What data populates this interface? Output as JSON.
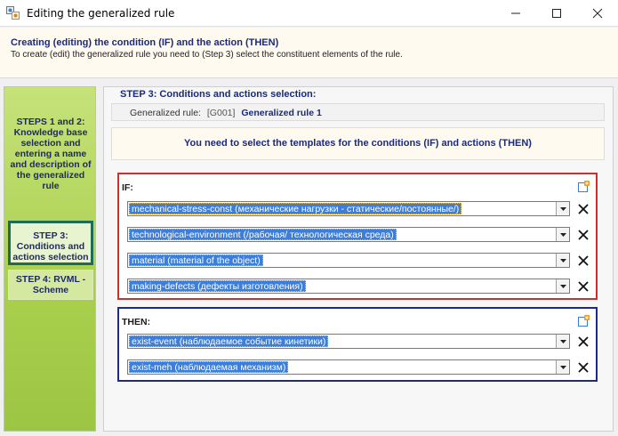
{
  "window": {
    "title": "Editing the generalized rule"
  },
  "header": {
    "title": "Creating (editing) the condition (IF) and the action (THEN)",
    "subtitle": "To create (edit) the generalized rule you need to (Step 3) select the constituent elements of the rule."
  },
  "sidebar": {
    "steps": [
      {
        "label": "STEPS 1 and 2: Knowledge base selection and entering a name and description of the generalized rule"
      },
      {
        "label": "STEP 3: Conditions and actions selection"
      },
      {
        "label": "STEP 4:  RVML - Scheme"
      }
    ]
  },
  "main": {
    "heading": "STEP 3: Conditions and actions selection:",
    "rule": {
      "label": "Generalized rule:",
      "code": "[G001]",
      "name": "Generalized rule 1"
    },
    "instruction": "You need to select the templates for the conditions (IF) and actions (THEN)",
    "if_section": {
      "label": "IF:",
      "items": [
        "mechanical-stress-const (механические нагрузки - статические/постоянные/)",
        "technological-environment (/рабочая/ технологическая среда)",
        "material (material of the object)",
        "making-defects (дефекты изготовления)"
      ]
    },
    "then_section": {
      "label": "THEN:",
      "items": [
        "exist-event (наблюдаемое событие кинетики)",
        "exist-meh (наблюдаемая механизм)"
      ]
    }
  },
  "colors": {
    "if_border": "#cf2f2f",
    "then_border": "#1c2a8a",
    "selection": "#3d7fd8",
    "heading_text": "#1a2a7c",
    "sidebar_green": "#a9cf4d"
  },
  "icons": {
    "app": "rule-editor-icon",
    "add": "add-item-icon",
    "delete": "close-x-icon",
    "dropdown": "chevron-down-icon"
  }
}
